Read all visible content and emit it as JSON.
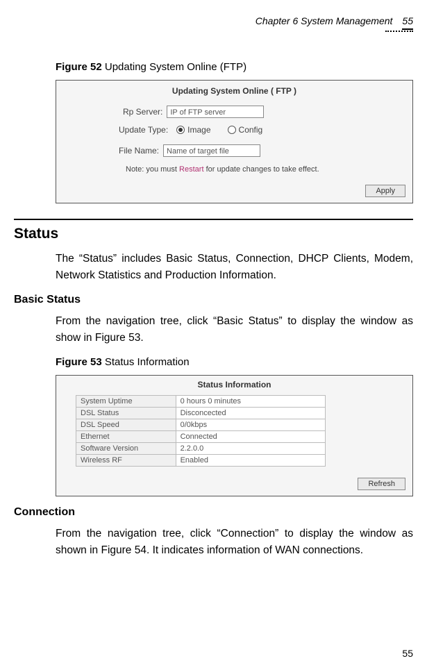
{
  "header": {
    "chapter": "Chapter 6 System Management",
    "page_top": "55"
  },
  "figure52": {
    "label": "Figure 52",
    "caption": "Updating System Online (FTP)",
    "panel_title": "Updating System Online ( FTP )",
    "ftp_label": "Rp  Server:",
    "ftp_placeholder": "IP of FTP server",
    "type_label": "Update Type:",
    "radio_image": "Image",
    "radio_config": "Config",
    "file_label": "File     Name:",
    "file_placeholder": "Name of target file",
    "note_prefix": "Note: you must ",
    "note_keyword": "Restart",
    "note_suffix": " for update changes to take effect.",
    "apply": "Apply"
  },
  "status": {
    "heading": "Status",
    "intro": "The “Status” includes Basic Status, Connection, DHCP Clients, Modem, Network Statistics and Production Information."
  },
  "basic": {
    "heading": "Basic Status",
    "text": "From the navigation tree, click “Basic Status” to display the window as show in Figure 53."
  },
  "figure53": {
    "label": "Figure 53",
    "caption": "Status Information",
    "panel_title": "Status Information",
    "rows": [
      {
        "k": "System Uptime",
        "v": "0 hours 0 minutes"
      },
      {
        "k": "DSL Status",
        "v": "Disconcected"
      },
      {
        "k": "DSL Speed",
        "v": "0/0kbps"
      },
      {
        "k": "Ethernet",
        "v": "Connected"
      },
      {
        "k": "Software Version",
        "v": "2.2.0.0"
      },
      {
        "k": "Wireless RF",
        "v": "Enabled"
      }
    ],
    "refresh": "Refresh"
  },
  "connection": {
    "heading": "Connection",
    "text": "From the navigation tree, click “Connection” to display the window as shown in Figure 54. It indicates information of WAN connections."
  },
  "footer_page": "55"
}
